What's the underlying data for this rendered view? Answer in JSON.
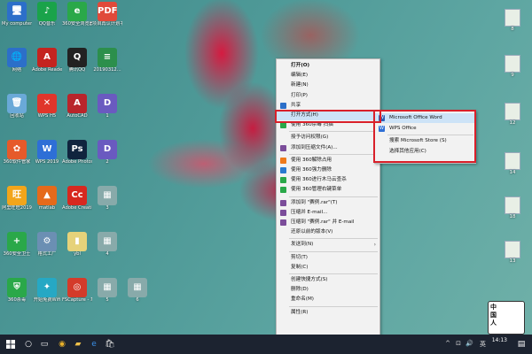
{
  "desktop_icons": [
    {
      "label": "My computer",
      "glyph": "🖥",
      "color": "#2c6fc9"
    },
    {
      "label": "QQ音乐",
      "glyph": "♪",
      "color": "#1aa34a"
    },
    {
      "label": "360安全浏览器",
      "glyph": "e",
      "color": "#2aa849"
    },
    {
      "label": "项目再认计划书",
      "glyph": "PDF",
      "color": "#e04a3a"
    },
    {
      "label": "网络",
      "glyph": "🌐",
      "color": "#2c6fc9"
    },
    {
      "label": "Adobe Reader XI",
      "glyph": "A",
      "color": "#c4241f"
    },
    {
      "label": "腾讯QQ",
      "glyph": "Q",
      "color": "#222"
    },
    {
      "label": "20190312...",
      "glyph": "≡",
      "color": "#2c8f4c"
    },
    {
      "label": "回收站",
      "glyph": "🗑",
      "color": "#6aa9d8"
    },
    {
      "label": "WPS H5",
      "glyph": "✕",
      "color": "#e0352b"
    },
    {
      "label": "AutoCAD",
      "glyph": "A",
      "color": "#b9252b"
    },
    {
      "label": "1",
      "glyph": "D",
      "color": "#6a5ac0"
    },
    {
      "label": "360软件管家",
      "glyph": "✿",
      "color": "#e65a2a"
    },
    {
      "label": "WPS 2019",
      "glyph": "W",
      "color": "#2e6fd6"
    },
    {
      "label": "Adobe Photosh...",
      "glyph": "Ps",
      "color": "#10243e"
    },
    {
      "label": "2",
      "glyph": "D",
      "color": "#6a5ac0"
    },
    {
      "label": "阿里旺旺2019",
      "glyph": "旺",
      "color": "#f2a51b"
    },
    {
      "label": "matlab",
      "glyph": "▲",
      "color": "#e56a1b"
    },
    {
      "label": "Adobe Creati...",
      "glyph": "Cc",
      "color": "#d7281f"
    },
    {
      "label": "3",
      "glyph": "▦",
      "color": "#8aa"
    },
    {
      "label": "360安全卫士",
      "glyph": "+",
      "color": "#2aa849"
    },
    {
      "label": "格式工厂",
      "glyph": "⚙",
      "color": "#6b8fb3"
    },
    {
      "label": "ybl",
      "glyph": "▮",
      "color": "#e6d27a"
    },
    {
      "label": "4",
      "glyph": "▦",
      "color": "#8aa"
    },
    {
      "label": "360杀毒",
      "glyph": "⛨",
      "color": "#2aa849"
    },
    {
      "label": "开始免费Wifi",
      "glyph": "✦",
      "color": "#26a8c4"
    },
    {
      "label": "FSCapture - 草文快速",
      "glyph": "◎",
      "color": "#d43b2a"
    },
    {
      "label": "5",
      "glyph": "▦",
      "color": "#8aa"
    },
    {
      "label": "6",
      "glyph": "▦",
      "color": "#8aa"
    }
  ],
  "right_icons": [
    "8",
    "9",
    "12",
    "14",
    "18",
    "13"
  ],
  "context_menu": {
    "items": [
      {
        "label": "打开(O)",
        "bold": true,
        "icon": ""
      },
      {
        "label": "编辑(E)",
        "icon": ""
      },
      {
        "label": "新建(N)",
        "icon": ""
      },
      {
        "label": "打印(P)",
        "icon": ""
      },
      {
        "label": "共享",
        "icon": "share",
        "icon_color": "#2c6fc9"
      },
      {
        "label": "打开方式(H)",
        "icon": "",
        "submenu": true,
        "highlighted": true
      },
      {
        "label": "使用 360杀毒 扫描",
        "icon": "shield",
        "icon_color": "#2aa849"
      },
      {
        "sep": true
      },
      {
        "label": "授予访问权限(G)",
        "icon": "",
        "submenu": true
      },
      {
        "label": "添加到压缩文件(A)...",
        "icon": "zip",
        "icon_color": "#7b4d9a"
      },
      {
        "sep": true
      },
      {
        "label": "使用 360解除占用",
        "icon": "360",
        "icon_color": "#f07a1a"
      },
      {
        "label": "使用 360强力删除",
        "icon": "360",
        "icon_color": "#2a7ad0"
      },
      {
        "label": "使用 360进行木马云查杀",
        "icon": "360",
        "icon_color": "#2aa849"
      },
      {
        "label": "使用 360管理右键菜单",
        "icon": "360",
        "icon_color": "#2aa849"
      },
      {
        "sep": true
      },
      {
        "label": "添加到 \"赛例.rar\"(T)",
        "icon": "zip",
        "icon_color": "#7b4d9a"
      },
      {
        "label": "压缩并 E-mail...",
        "icon": "zip",
        "icon_color": "#7b4d9a"
      },
      {
        "label": "压缩到 \"赛例.rar\" 并 E-mail",
        "icon": "zip",
        "icon_color": "#7b4d9a"
      },
      {
        "label": "还原以前的版本(V)",
        "icon": ""
      },
      {
        "sep": true
      },
      {
        "label": "发送到(N)",
        "icon": "",
        "submenu": true
      },
      {
        "sep": true
      },
      {
        "label": "剪切(T)",
        "icon": ""
      },
      {
        "label": "复制(C)",
        "icon": ""
      },
      {
        "sep": true
      },
      {
        "label": "创建快捷方式(S)",
        "icon": ""
      },
      {
        "label": "删除(D)",
        "icon": ""
      },
      {
        "label": "重命名(M)",
        "icon": ""
      },
      {
        "sep": true
      },
      {
        "label": "属性(R)",
        "icon": ""
      }
    ]
  },
  "submenu": {
    "items": [
      {
        "label": "Microsoft Office Word",
        "icon": "W",
        "icon_color": "#2b5fb4",
        "highlighted": true
      },
      {
        "label": "WPS Office",
        "icon": "W",
        "icon_color": "#2e6fd6"
      },
      {
        "sep": true
      },
      {
        "label": "搜索 Microsoft Store (S)",
        "icon": ""
      },
      {
        "label": "选择其他应用(C)",
        "icon": ""
      }
    ]
  },
  "taskbar": {
    "start_icon": "windows-logo",
    "time": "14:13",
    "tray": [
      "^",
      "⊡",
      "🔊",
      "英"
    ]
  },
  "watermark": "中国人"
}
